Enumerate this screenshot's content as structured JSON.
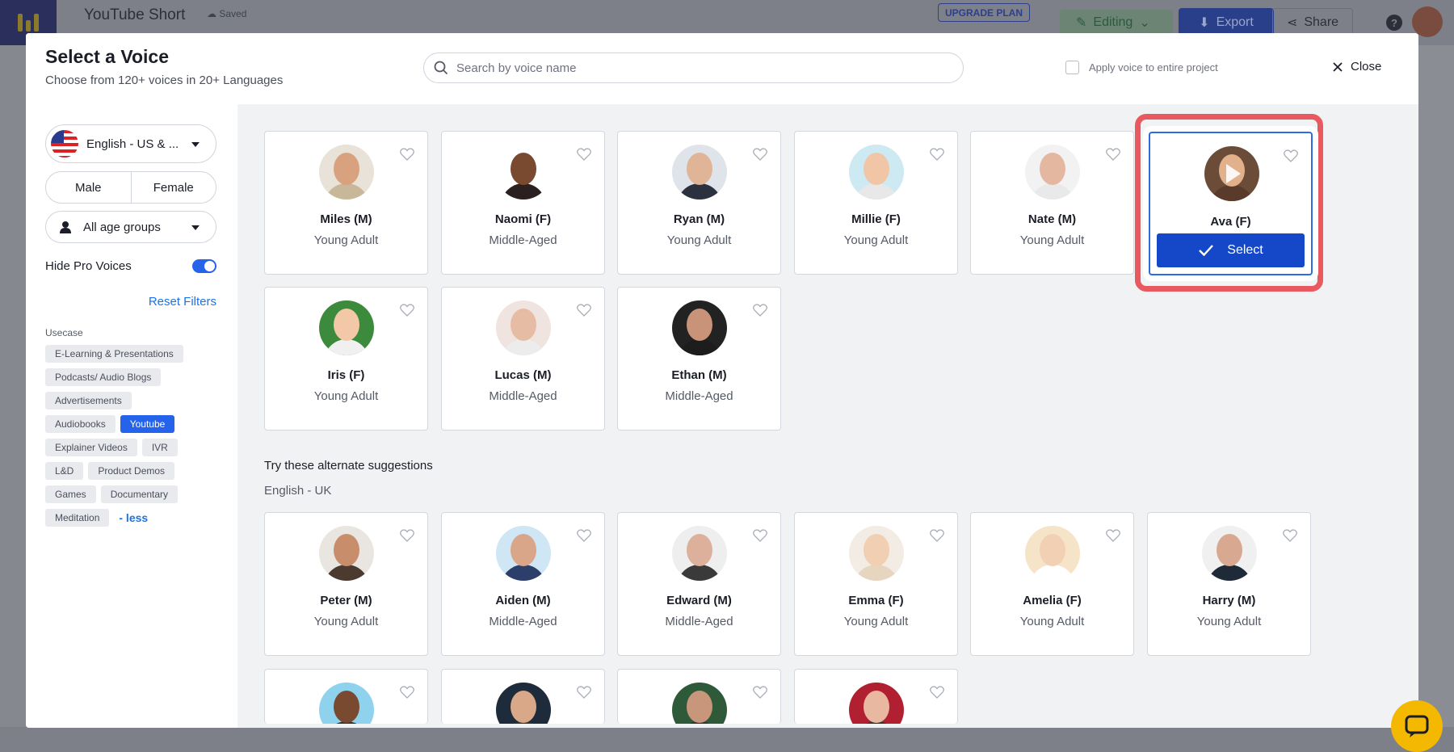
{
  "app": {
    "project_title": "YouTube Short",
    "saved_label": "Saved",
    "upgrade_label": "UPGRADE PLAN",
    "editing_label": "Editing",
    "export_label": "Export",
    "share_label": "Share",
    "help_label": "?"
  },
  "modal": {
    "title": "Select a Voice",
    "subtitle": "Choose from 120+ voices in 20+ Languages",
    "search_placeholder": "Search by voice name",
    "apply_label": "Apply voice to entire project",
    "close_label": "Close"
  },
  "filters": {
    "language": "English - US & ...",
    "gender_options": [
      "Male",
      "Female"
    ],
    "age_group": "All age groups",
    "hide_pro_label": "Hide Pro Voices",
    "hide_pro_enabled": true,
    "reset_label": "Reset Filters",
    "usecase_label": "Usecase",
    "usecases": [
      "E-Learning & Presentations",
      "Podcasts/ Audio Blogs",
      "Advertisements",
      "Audiobooks",
      "Youtube",
      "Explainer Videos",
      "IVR",
      "L&D",
      "Product Demos",
      "Games",
      "Documentary",
      "Meditation"
    ],
    "active_usecase": "Youtube",
    "less_label": "- less"
  },
  "voices": [
    {
      "name": "Miles (M)",
      "age": "Young Adult",
      "skin": "#d9a27e",
      "shirt": "#c9b79a",
      "bg": "#e8e2d8"
    },
    {
      "name": "Naomi (F)",
      "age": "Middle-Aged",
      "skin": "#7a4a30",
      "shirt": "#2b2020",
      "bg": "#ffffff"
    },
    {
      "name": "Ryan (M)",
      "age": "Young Adult",
      "skin": "#e0b496",
      "shirt": "#2c3140",
      "bg": "#dfe4ea"
    },
    {
      "name": "Millie (F)",
      "age": "Young Adult",
      "skin": "#f0c6a6",
      "shirt": "#e8e8e8",
      "bg": "#cdeaf2"
    },
    {
      "name": "Nate (M)",
      "age": "Young Adult",
      "skin": "#e4b8a0",
      "shirt": "#e9e9e9",
      "bg": "#f2f2f2"
    },
    {
      "name": "Ava (F)",
      "age": "",
      "skin": "#e2b08a",
      "shirt": "#5a3a2a",
      "bg": "#6b4c38"
    },
    {
      "name": "Iris (F)",
      "age": "Young Adult",
      "skin": "#f2c8a8",
      "shirt": "#f0f0f0",
      "bg": "#3c8a3c"
    },
    {
      "name": "Lucas (M)",
      "age": "Middle-Aged",
      "skin": "#e6bca4",
      "shirt": "#ececec",
      "bg": "#f0e4e0"
    },
    {
      "name": "Ethan (M)",
      "age": "Middle-Aged",
      "skin": "#c9937a",
      "shirt": "#1d1d1d",
      "bg": "#222222"
    }
  ],
  "selected_voice": "Ava (F)",
  "select_label": "Select",
  "alternate": {
    "title": "Try these alternate suggestions",
    "language": "English - UK",
    "voices": [
      {
        "name": "Peter (M)",
        "age": "Young Adult",
        "skin": "#c88e6c",
        "shirt": "#4a3a30",
        "bg": "#e9e6e2"
      },
      {
        "name": "Aiden (M)",
        "age": "Middle-Aged",
        "skin": "#d9a68a",
        "shirt": "#2b3f6a",
        "bg": "#cfe6f4"
      },
      {
        "name": "Edward (M)",
        "age": "Middle-Aged",
        "skin": "#dcb09a",
        "shirt": "#3a3a3a",
        "bg": "#eeeeee"
      },
      {
        "name": "Emma (F)",
        "age": "Young Adult",
        "skin": "#f0cfb2",
        "shirt": "#e6d6c0",
        "bg": "#f2ece4"
      },
      {
        "name": "Amelia (F)",
        "age": "Young Adult",
        "skin": "#f2d0b4",
        "shirt": "#ffffff",
        "bg": "#f6e4c8"
      },
      {
        "name": "Harry (M)",
        "age": "Young Adult",
        "skin": "#d8a890",
        "shirt": "#1f2a38",
        "bg": "#f0f0f0"
      }
    ],
    "partial": [
      {
        "skin": "#7a4a30",
        "bg": "#8fd2ee"
      },
      {
        "skin": "#d8a888",
        "bg": "#1e2b3a"
      },
      {
        "skin": "#c8967a",
        "bg": "#2e5a3a"
      },
      {
        "skin": "#e8b8a0",
        "bg": "#b02030"
      }
    ]
  }
}
